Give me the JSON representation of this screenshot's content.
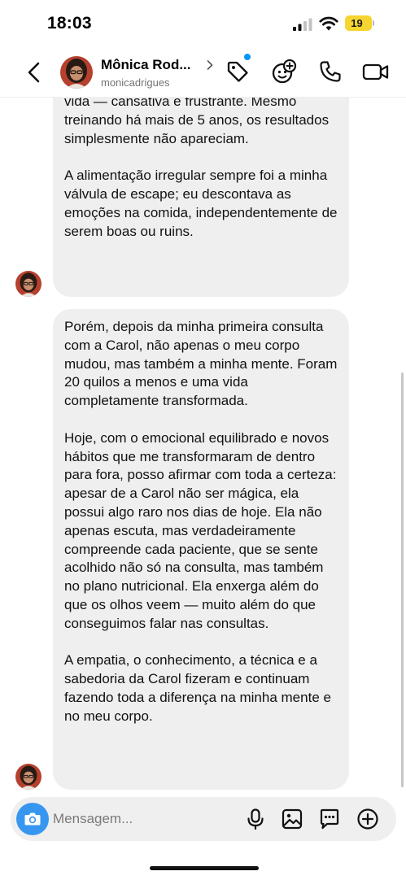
{
  "status_bar": {
    "time": "18:03",
    "battery": "19"
  },
  "header": {
    "contact_name": "Mônica Rod...",
    "contact_handle": "monicadrigues",
    "icons": [
      "back-arrow-icon",
      "tag-icon",
      "effects-icon",
      "phone-icon",
      "video-icon"
    ]
  },
  "messages": [
    {
      "paragraphs": [
        "vida — cansativa e frustrante. Mesmo treinando há mais de 5 anos, os resultados simplesmente não apareciam.",
        "A alimentação irregular sempre foi a minha válvula de escape; eu descontava as emoções na comida, independentemente de serem boas ou ruins."
      ]
    },
    {
      "paragraphs": [
        "Porém, depois da minha primeira consulta com a Carol, não apenas o meu corpo mudou, mas também a minha mente. Foram 20 quilos a menos e uma vida completamente transformada.",
        "Hoje, com o emocional equilibrado e novos hábitos que me transformaram de dentro para fora, posso afirmar com toda a certeza: apesar de a Carol não ser mágica, ela possui algo raro nos dias de hoje. Ela não apenas escuta, mas verdadeiramente compreende cada paciente, que se sente acolhido não só na consulta, mas também no plano nutricional. Ela enxerga além do que os olhos veem — muito além do que conseguimos falar nas consultas.",
        "A empatia, o conhecimento, a técnica e a sabedoria da Carol fizeram e continuam fazendo toda a diferença na minha mente e no meu corpo."
      ]
    }
  ],
  "composer": {
    "placeholder": "Mensagem...",
    "icons": [
      "camera-icon",
      "microphone-icon",
      "gallery-icon",
      "sticker-icon",
      "plus-icon"
    ]
  },
  "colors": {
    "accent": "#3797f0",
    "bubble": "#efefef",
    "battery": "#f7d531",
    "notification_dot": "#0095f6"
  }
}
